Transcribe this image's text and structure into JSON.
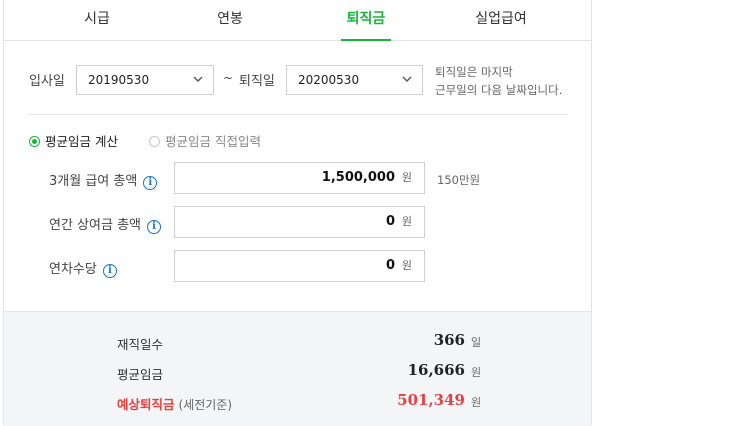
{
  "tabs": [
    {
      "label": "시급"
    },
    {
      "label": "연봉"
    },
    {
      "label": "퇴직금"
    },
    {
      "label": "실업급여"
    }
  ],
  "active_tab": "퇴직금",
  "accent_color": "#19b53b",
  "period": {
    "start_label": "입사일",
    "start_value": "20190530",
    "separator": "~",
    "end_label": "퇴직일",
    "end_value": "20200530",
    "note_line1": "퇴직일은 마지막",
    "note_line2": "근무일의 다음 날짜입니다."
  },
  "mode": {
    "option1": "평균임금 계산",
    "option2": "평균임금 직접입력",
    "selected": "평균임금 계산"
  },
  "fields": [
    {
      "label": "3개월 급여 총액",
      "value": "1,500,000",
      "unit": "원",
      "hint": "150만원"
    },
    {
      "label": "연간 상여금 총액",
      "value": "0",
      "unit": "원",
      "hint": ""
    },
    {
      "label": "연차수당",
      "value": "0",
      "unit": "원",
      "hint": ""
    }
  ],
  "results": {
    "days_label": "재직일수",
    "days_value": "366",
    "days_unit": "일",
    "avg_label": "평균임금",
    "avg_value": "16,666",
    "avg_unit": "원",
    "sev_label": "예상퇴직금",
    "sev_sub": "(세전기준)",
    "sev_value": "501,349",
    "sev_unit": "원",
    "highlight_color": "#e54040"
  },
  "icons": [
    "chevron-down-icon",
    "info-icon"
  ]
}
